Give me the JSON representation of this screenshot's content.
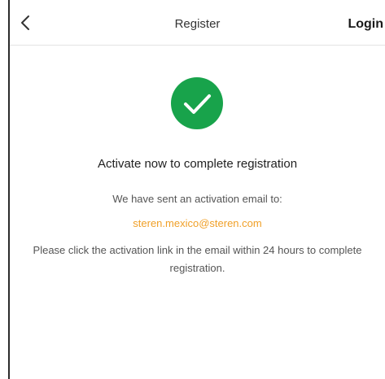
{
  "header": {
    "back_icon": "chevron-left-icon",
    "title": "Register",
    "login_label": "Login"
  },
  "status": {
    "icon": "checkmark-circle-icon",
    "color": "#18a34b"
  },
  "content": {
    "headline": "Activate now to complete registration",
    "sent_text": "We have sent an activation email to:",
    "email": "steren.mexico@steren.com",
    "email_color": "#f0a028",
    "instructions": "Please click the activation link in the email within 24 hours to complete registration."
  }
}
